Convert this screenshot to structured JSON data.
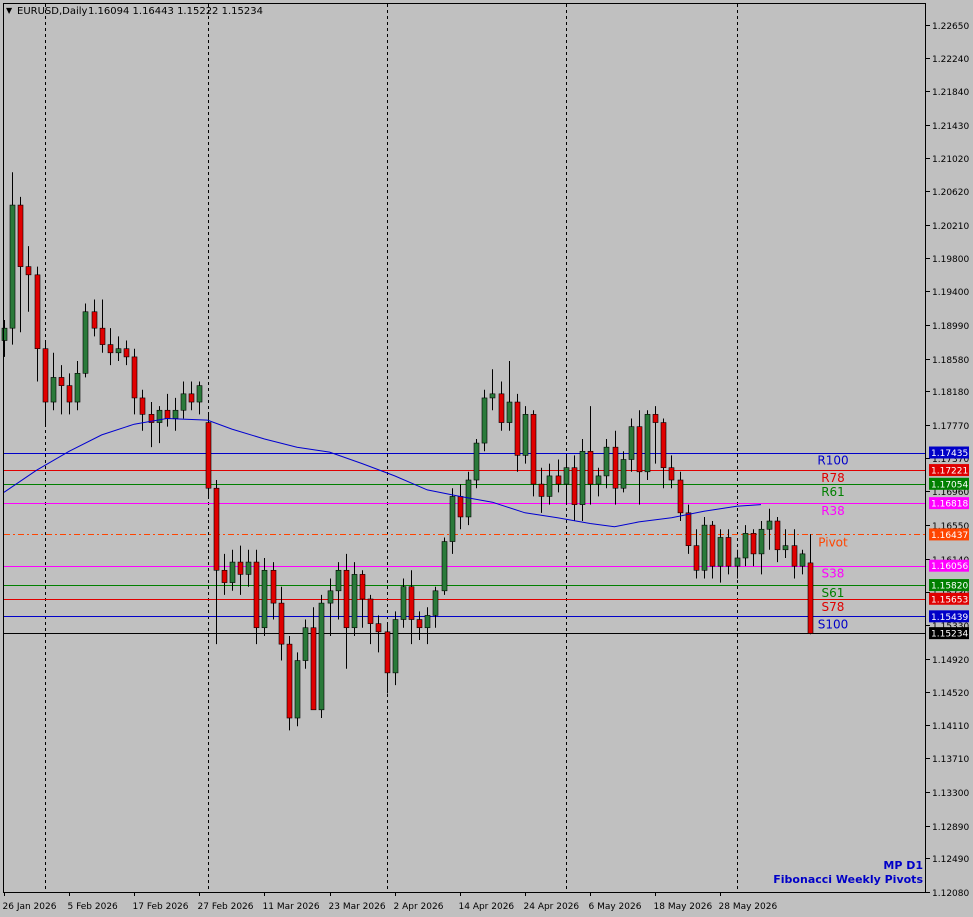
{
  "header": {
    "symbol": "EURUSD,Daily",
    "ohlc": "1.16094 1.16443 1.15222 1.15234"
  },
  "watermark": {
    "line1": "MP D1",
    "line2": "Fibonacci Weekly Pivots"
  },
  "colors": {
    "background": "#c0c0c0",
    "bull": "#2a7a3a",
    "bear": "#e00000",
    "wick": "#000000",
    "ma": "#0000d0",
    "grid": "#000000"
  },
  "chart_data": {
    "type": "candlestick",
    "title": "EURUSD,Daily",
    "ylim": [
      1.1208,
      1.229
    ],
    "y_ticks": [
      "1.22650",
      "1.22240",
      "1.21840",
      "1.21430",
      "1.21020",
      "1.20620",
      "1.20210",
      "1.19800",
      "1.19400",
      "1.18990",
      "1.18580",
      "1.18180",
      "1.17770",
      "1.17370",
      "1.16960",
      "1.16550",
      "1.16140",
      "1.15730",
      "1.15330",
      "1.14920",
      "1.14520",
      "1.14110",
      "1.13710",
      "1.13300",
      "1.12890",
      "1.12490",
      "1.12080"
    ],
    "y_tick_values": [
      1.2265,
      1.2224,
      1.2184,
      1.2143,
      1.2102,
      1.2062,
      1.2021,
      1.198,
      1.194,
      1.1899,
      1.1858,
      1.1818,
      1.1777,
      1.1737,
      1.1696,
      1.1655,
      1.1614,
      1.1573,
      1.1533,
      1.1492,
      1.1452,
      1.1411,
      1.1371,
      1.133,
      1.1289,
      1.1249,
      1.1208
    ],
    "x_labels": [
      {
        "label": "26 Jan 2026",
        "index": 0
      },
      {
        "label": "5 Feb 2026",
        "index": 8
      },
      {
        "label": "17 Feb 2026",
        "index": 16
      },
      {
        "label": "27 Feb 2026",
        "index": 24
      },
      {
        "label": "11 Mar 2026",
        "index": 32
      },
      {
        "label": "23 Mar 2026",
        "index": 40
      },
      {
        "label": "2 Apr 2026",
        "index": 48
      },
      {
        "label": "14 Apr 2026",
        "index": 56
      },
      {
        "label": "24 Apr 2026",
        "index": 64
      },
      {
        "label": "6 May 2026",
        "index": 72
      },
      {
        "label": "18 May 2026",
        "index": 80
      },
      {
        "label": "28 May 2026",
        "index": 88
      }
    ],
    "period_separators": [
      5,
      25,
      47,
      69,
      90
    ],
    "candles": [
      [
        1.188,
        1.1905,
        1.186,
        1.1895
      ],
      [
        1.1895,
        1.2085,
        1.1875,
        1.2045
      ],
      [
        1.2045,
        1.2055,
        1.189,
        1.197
      ],
      [
        1.197,
        1.1995,
        1.1915,
        1.196
      ],
      [
        1.196,
        1.197,
        1.183,
        1.187
      ],
      [
        1.187,
        1.188,
        1.1775,
        1.1805
      ],
      [
        1.1805,
        1.1865,
        1.1795,
        1.1835
      ],
      [
        1.1835,
        1.185,
        1.179,
        1.1825
      ],
      [
        1.1825,
        1.184,
        1.179,
        1.1805
      ],
      [
        1.1805,
        1.1855,
        1.1795,
        1.184
      ],
      [
        1.184,
        1.1925,
        1.1835,
        1.1915
      ],
      [
        1.1915,
        1.193,
        1.1885,
        1.1895
      ],
      [
        1.1895,
        1.193,
        1.1865,
        1.1875
      ],
      [
        1.1875,
        1.1895,
        1.185,
        1.1865
      ],
      [
        1.1865,
        1.1885,
        1.1855,
        1.187
      ],
      [
        1.187,
        1.188,
        1.185,
        1.186
      ],
      [
        1.186,
        1.187,
        1.179,
        1.181
      ],
      [
        1.181,
        1.182,
        1.177,
        1.179
      ],
      [
        1.179,
        1.1805,
        1.175,
        1.178
      ],
      [
        1.178,
        1.18,
        1.1755,
        1.1795
      ],
      [
        1.1795,
        1.1815,
        1.1775,
        1.1785
      ],
      [
        1.1785,
        1.181,
        1.177,
        1.1795
      ],
      [
        1.1795,
        1.183,
        1.1785,
        1.1815
      ],
      [
        1.1815,
        1.183,
        1.1795,
        1.1805
      ],
      [
        1.1805,
        1.183,
        1.179,
        1.1825
      ],
      [
        1.178,
        1.179,
        1.169,
        1.17
      ],
      [
        1.17,
        1.171,
        1.151,
        1.16
      ],
      [
        1.16,
        1.162,
        1.157,
        1.1585
      ],
      [
        1.1585,
        1.1625,
        1.1575,
        1.161
      ],
      [
        1.161,
        1.163,
        1.157,
        1.1595
      ],
      [
        1.1595,
        1.1625,
        1.158,
        1.161
      ],
      [
        1.161,
        1.1625,
        1.151,
        1.153
      ],
      [
        1.153,
        1.1615,
        1.152,
        1.16
      ],
      [
        1.16,
        1.161,
        1.154,
        1.156
      ],
      [
        1.156,
        1.158,
        1.149,
        1.151
      ],
      [
        1.151,
        1.152,
        1.1405,
        1.142
      ],
      [
        1.142,
        1.15,
        1.141,
        1.149
      ],
      [
        1.149,
        1.154,
        1.148,
        1.153
      ],
      [
        1.153,
        1.1555,
        1.146,
        1.143
      ],
      [
        1.143,
        1.157,
        1.142,
        1.156
      ],
      [
        1.156,
        1.159,
        1.152,
        1.1575
      ],
      [
        1.1575,
        1.161,
        1.154,
        1.16
      ],
      [
        1.16,
        1.162,
        1.148,
        1.153
      ],
      [
        1.153,
        1.161,
        1.152,
        1.1595
      ],
      [
        1.1595,
        1.16,
        1.153,
        1.1565
      ],
      [
        1.1565,
        1.157,
        1.151,
        1.1535
      ],
      [
        1.1535,
        1.1545,
        1.15,
        1.1525
      ],
      [
        1.1525,
        1.1535,
        1.145,
        1.1475
      ],
      [
        1.1475,
        1.155,
        1.146,
        1.154
      ],
      [
        1.154,
        1.159,
        1.153,
        1.158
      ],
      [
        1.158,
        1.16,
        1.151,
        1.154
      ],
      [
        1.154,
        1.155,
        1.1515,
        1.153
      ],
      [
        1.153,
        1.1555,
        1.151,
        1.1545
      ],
      [
        1.1545,
        1.158,
        1.153,
        1.1575
      ],
      [
        1.1575,
        1.164,
        1.157,
        1.1635
      ],
      [
        1.1635,
        1.17,
        1.162,
        1.169
      ],
      [
        1.169,
        1.1705,
        1.165,
        1.1665
      ],
      [
        1.1665,
        1.172,
        1.1655,
        1.171
      ],
      [
        1.171,
        1.176,
        1.17,
        1.1755
      ],
      [
        1.1755,
        1.182,
        1.1745,
        1.181
      ],
      [
        1.181,
        1.1845,
        1.1795,
        1.1815
      ],
      [
        1.1815,
        1.183,
        1.177,
        1.178
      ],
      [
        1.178,
        1.1855,
        1.177,
        1.1805
      ],
      [
        1.1805,
        1.1815,
        1.172,
        1.174
      ],
      [
        1.174,
        1.18,
        1.173,
        1.179
      ],
      [
        1.179,
        1.1795,
        1.169,
        1.1705
      ],
      [
        1.1705,
        1.1725,
        1.167,
        1.169
      ],
      [
        1.169,
        1.173,
        1.168,
        1.1715
      ],
      [
        1.1715,
        1.1735,
        1.1695,
        1.1705
      ],
      [
        1.1705,
        1.174,
        1.168,
        1.1725
      ],
      [
        1.1725,
        1.174,
        1.166,
        1.168
      ],
      [
        1.168,
        1.176,
        1.166,
        1.1745
      ],
      [
        1.1745,
        1.18,
        1.168,
        1.1705
      ],
      [
        1.1705,
        1.1725,
        1.169,
        1.1715
      ],
      [
        1.1715,
        1.176,
        1.17,
        1.175
      ],
      [
        1.175,
        1.177,
        1.168,
        1.17
      ],
      [
        1.17,
        1.1745,
        1.1695,
        1.1735
      ],
      [
        1.1735,
        1.1785,
        1.172,
        1.1775
      ],
      [
        1.1775,
        1.1795,
        1.168,
        1.172
      ],
      [
        1.172,
        1.1795,
        1.171,
        1.179
      ],
      [
        1.179,
        1.18,
        1.173,
        1.178
      ],
      [
        1.178,
        1.1785,
        1.17,
        1.1725
      ],
      [
        1.1725,
        1.174,
        1.17,
        1.171
      ],
      [
        1.171,
        1.172,
        1.166,
        1.167
      ],
      [
        1.167,
        1.168,
        1.162,
        1.163
      ],
      [
        1.163,
        1.165,
        1.159,
        1.16
      ],
      [
        1.16,
        1.1665,
        1.159,
        1.1655
      ],
      [
        1.1655,
        1.166,
        1.159,
        1.1605
      ],
      [
        1.1605,
        1.165,
        1.1585,
        1.164
      ],
      [
        1.164,
        1.165,
        1.1595,
        1.1605
      ],
      [
        1.1605,
        1.1625,
        1.159,
        1.1615
      ],
      [
        1.1615,
        1.1655,
        1.1605,
        1.1645
      ],
      [
        1.1645,
        1.165,
        1.1605,
        1.162
      ],
      [
        1.162,
        1.166,
        1.1595,
        1.165
      ],
      [
        1.165,
        1.1675,
        1.1625,
        1.166
      ],
      [
        1.166,
        1.1665,
        1.161,
        1.1625
      ],
      [
        1.1625,
        1.165,
        1.1615,
        1.163
      ],
      [
        1.163,
        1.165,
        1.159,
        1.1605
      ],
      [
        1.1605,
        1.1625,
        1.1595,
        1.162
      ],
      [
        1.1609,
        1.1644,
        1.1522,
        1.1523
      ]
    ],
    "ma": [
      [
        0,
        1.1695
      ],
      [
        4,
        1.1722
      ],
      [
        8,
        1.1745
      ],
      [
        12,
        1.1765
      ],
      [
        16,
        1.1778
      ],
      [
        20,
        1.1785
      ],
      [
        25,
        1.1783
      ],
      [
        28,
        1.1772
      ],
      [
        32,
        1.176
      ],
      [
        36,
        1.175
      ],
      [
        40,
        1.1744
      ],
      [
        44,
        1.173
      ],
      [
        48,
        1.1715
      ],
      [
        52,
        1.1698
      ],
      [
        56,
        1.169
      ],
      [
        60,
        1.1683
      ],
      [
        64,
        1.167
      ],
      [
        68,
        1.1664
      ],
      [
        72,
        1.1657
      ],
      [
        75,
        1.1653
      ],
      [
        78,
        1.1659
      ],
      [
        82,
        1.1664
      ],
      [
        86,
        1.1672
      ],
      [
        90,
        1.1678
      ],
      [
        93,
        1.168
      ]
    ],
    "pivot_levels": [
      {
        "name": "R100",
        "value": 1.17435,
        "label": "1.17435",
        "color": "#0000c8",
        "style": "solid"
      },
      {
        "name": "R78",
        "value": 1.17221,
        "label": "1.17221",
        "color": "#e00000",
        "style": "solid"
      },
      {
        "name": "R61",
        "value": 1.17054,
        "label": "1.17054",
        "color": "#008000",
        "style": "solid"
      },
      {
        "name": "R38",
        "value": 1.16818,
        "label": "1.16818",
        "color": "#ff00ff",
        "style": "solid"
      },
      {
        "name": "Pivot",
        "value": 1.16437,
        "label": "1.16437",
        "color": "#ff4500",
        "style": "dashdot"
      },
      {
        "name": "S38",
        "value": 1.16056,
        "label": "1.16056",
        "color": "#ff00ff",
        "style": "solid"
      },
      {
        "name": "S61",
        "value": 1.1582,
        "label": "1.15820",
        "color": "#008000",
        "style": "solid"
      },
      {
        "name": "S78",
        "value": 1.15653,
        "label": "1.15653",
        "color": "#e00000",
        "style": "solid"
      },
      {
        "name": "S100",
        "value": 1.15439,
        "label": "1.15439",
        "color": "#0000c8",
        "style": "solid"
      }
    ],
    "current_price": {
      "value": 1.15234,
      "label": "1.15234"
    }
  }
}
